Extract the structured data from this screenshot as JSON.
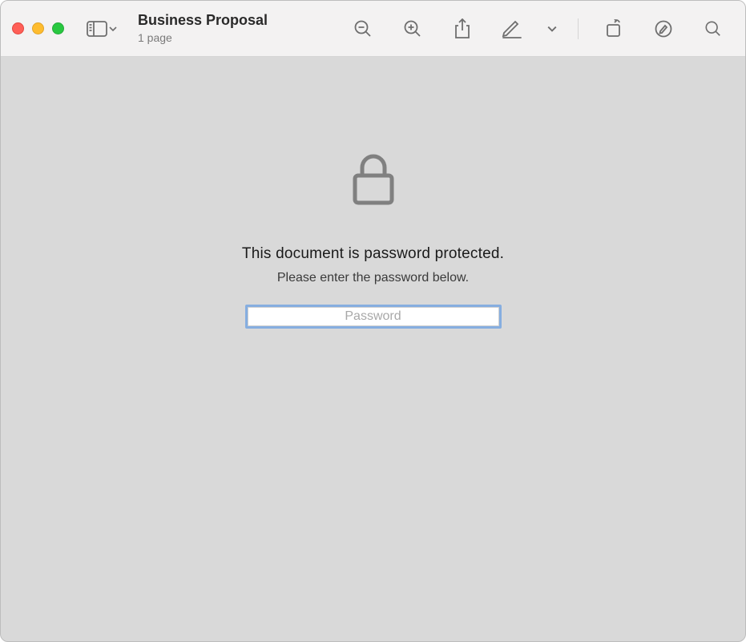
{
  "window": {
    "title": "Business Proposal",
    "subtitle": "1 page"
  },
  "toolbar": {
    "icons": {
      "sidebar": "sidebar-icon",
      "zoom_out": "zoom-out-icon",
      "zoom_in": "zoom-in-icon",
      "share": "share-icon",
      "markup": "markup-icon",
      "rotate": "rotate-icon",
      "highlight": "highlight-icon",
      "search": "search-icon"
    }
  },
  "content": {
    "headline": "This document is password protected.",
    "subline": "Please enter the password below.",
    "password_placeholder": "Password"
  }
}
